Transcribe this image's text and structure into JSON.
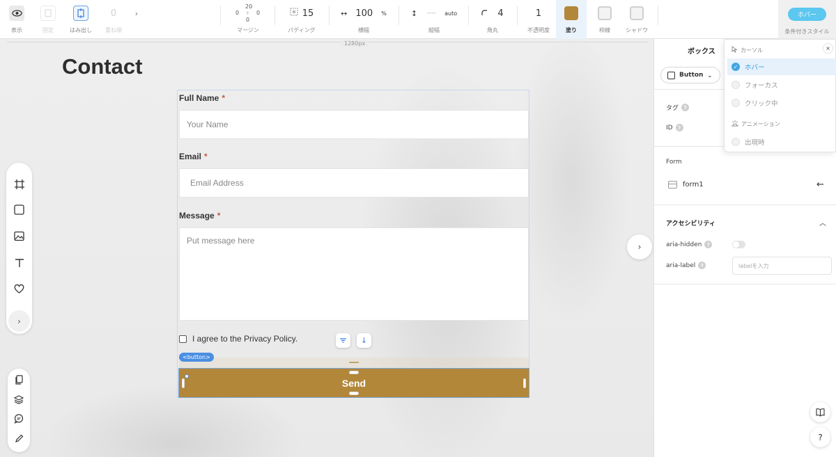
{
  "toolbar": {
    "view_label": "表示",
    "fix_label": "固定",
    "overflow_label": "はみ出し",
    "stack_value": "0",
    "stack_label": "重ね順",
    "margin": {
      "top": "20",
      "left": "0",
      "right": "0",
      "bottom": "0",
      "label": "マージン"
    },
    "padding": {
      "value": "15",
      "label": "パディング"
    },
    "width": {
      "value": "100",
      "unit": "%",
      "label": "横幅"
    },
    "height": {
      "value": "----",
      "unit": "auto",
      "label": "縦幅"
    },
    "radius": {
      "value": "4",
      "label": "角丸"
    },
    "opacity": {
      "value": "1",
      "label": "不透明度"
    },
    "fill_label": "塗り",
    "border_label": "枠線",
    "shadow_label": "シャドウ",
    "hover_pill": "ホバー",
    "conditional_label": "条件付きスタイル"
  },
  "canvas": {
    "ruler_label": "1280px",
    "title": "Contact",
    "form": {
      "full_name_label": "Full Name",
      "full_name_placeholder": "Your Name",
      "email_label": "Email",
      "email_placeholder": "Email Address",
      "message_label": "Message",
      "message_placeholder": "Put message here",
      "required_mark": "*",
      "agree_text": "I agree to the Privacy Policy.",
      "button_tag": "<button>",
      "send_label": "Send"
    }
  },
  "panel": {
    "tab_box": "ボックス",
    "element_select": "Button",
    "tag_label": "タグ",
    "id_label": "ID",
    "form_section": "Form",
    "form_item": "form1",
    "accessibility_title": "アクセシビリティ",
    "aria_hidden_label": "aria-hidden",
    "aria_label_label": "aria-label",
    "aria_label_placeholder": "labelを入力"
  },
  "dropdown": {
    "cursor_group": "カーソル",
    "hover": "ホバー",
    "focus": "フォーカス",
    "click": "クリック中",
    "animation_group": "アニメーション",
    "appear": "出現時"
  },
  "colors": {
    "accent_fill": "#b2873a",
    "selection_blue": "#4b8fe2",
    "hover_pill": "#5cc7ef"
  }
}
